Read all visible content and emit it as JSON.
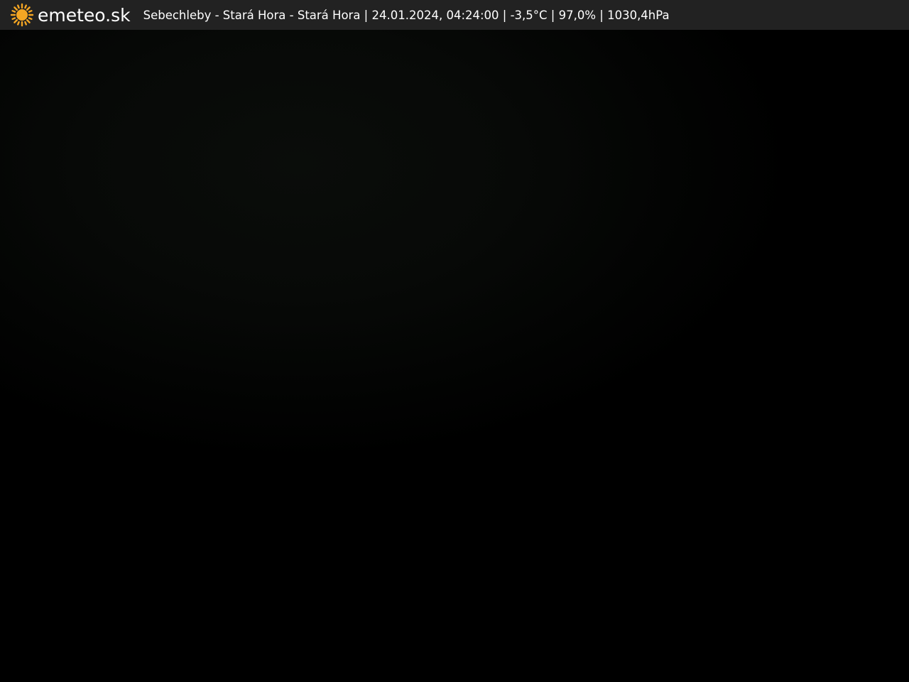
{
  "header": {
    "brand": "emeteo.sk",
    "logo_icon": "sun-icon",
    "caption": "Sebechleby - Stará Hora - Stará Hora | 24.01.2024, 04:24:00 | -3,5°C | 97,0% | 1030,4hPa"
  },
  "colors": {
    "bar_background": "#222222",
    "sun": "#f5a623",
    "text": "#ffffff",
    "scene": "#000000"
  }
}
